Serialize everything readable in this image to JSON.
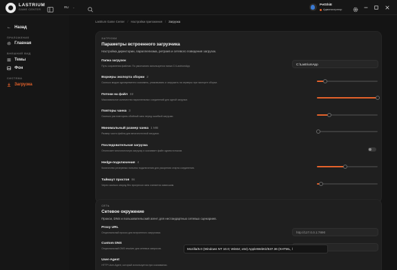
{
  "brand": {
    "name": "LASTRIUM",
    "subtitle": "GAME CENTER"
  },
  "topbar": {
    "language": "RU"
  },
  "user": {
    "name": "PetShiE",
    "role": "Администратор"
  },
  "sidebar": {
    "back_label": "Назад",
    "sections": [
      {
        "label": "ПРИЛОЖЕНИЕ",
        "items": [
          {
            "label": "Главная",
            "icon": "gear-icon"
          }
        ]
      },
      {
        "label": "ВНЕШНИЙ ВИД",
        "items": [
          {
            "label": "Темы",
            "icon": "hamburger-icon"
          },
          {
            "label": "Фон",
            "icon": "image-icon"
          }
        ]
      },
      {
        "label": "СИСТЕМА",
        "items": [
          {
            "label": "Загрузка",
            "icon": "download-icon",
            "active": true
          }
        ]
      }
    ]
  },
  "breadcrumb": [
    "Lastrium Game Center",
    "Настройки приложения",
    "Загрузка"
  ],
  "card1": {
    "kicker": "ЗАГРУЗКИ",
    "title": "Параметры встроенного загрузчика",
    "description": "Настройка директории, параллелизма, ретраев и сетевого поведения загрузок.",
    "rows": [
      {
        "label": "Папка загрузок",
        "value": "",
        "desc": "Путь сохранения файлов. По умолчанию используется папка C:\\LastriumApp",
        "control": "input",
        "input_value": "C:\\LastriumApp"
      },
      {
        "label": "Воркеры экспорта сборки",
        "value": "2",
        "desc": "Сколько модов одновременно скачивать, упаковывать и загружать на серверы при экспорте сборки.",
        "control": "slider",
        "level": 0.14
      },
      {
        "label": "Потоки на файл",
        "value": "32",
        "desc": "Максимальное количество параллельных соединений для одной загрузки.",
        "control": "slider",
        "level": 1.0
      },
      {
        "label": "Повторы чанка",
        "value": "3",
        "desc": "Сколько раз повторять сбойный чанк перед ошибкой загрузки.",
        "control": "slider",
        "level": 0.2
      },
      {
        "label": "Минимальный размер чанка",
        "value": "1 MB",
        "desc": "Размер части файла для многопоточной загрузки.",
        "control": "slider",
        "level": 0.02
      },
      {
        "label": "Последовательная загрузка",
        "value": "",
        "desc": "Отключает многопоточную загрузку и скачивает файл одним потоком.",
        "control": "toggle",
        "on": false
      },
      {
        "label": "Hedge-подключения",
        "value": "4",
        "desc": "Количество резервных попыток подключения для ускорения старта соединения.",
        "control": "slider",
        "level": 0.47
      },
      {
        "label": "Таймаут простоя",
        "value": "8s",
        "desc": "Через сколько секунд без прогресса чанк считается зависшим.",
        "control": "slider",
        "level": 0.07
      }
    ]
  },
  "card2": {
    "kicker": "СЕТЬ",
    "title": "Сетевое окружение",
    "description": "Прокси, DNS и пользовательский агент для нестандартных сетевых сценариев.",
    "rows": [
      {
        "label": "Proxy URL",
        "desc": "Опциональный прокси для встроенного загрузчика.",
        "placeholder": "http://127.0.0.1:7890"
      },
      {
        "label": "Custom DNS",
        "desc": "Опциональный DNS resolver для сетевых запросов.",
        "placeholder": "1.1.1.1:53"
      },
      {
        "label": "User-Agent",
        "desc": "HTTP User-Agent, который используется при скачивании."
      }
    ]
  },
  "user_agent_value": "Mozilla/5.0 (Windows NT 10.0; Win64; x64) AppleWebKit/537.36 (KHTML, l",
  "colors": {
    "accent": "#e8632b",
    "background": "#141414",
    "card": "#1f1f1f"
  }
}
